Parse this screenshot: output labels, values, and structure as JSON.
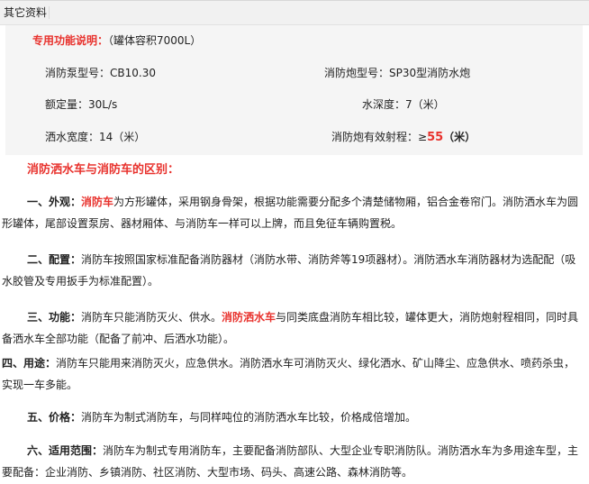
{
  "section_tab": "其它资料",
  "specs": {
    "title_label": "专用功能说明：",
    "title_note": "（罐体容积7000L）",
    "pump_model": "消防泵型号：CB10.30",
    "cannon_model": "消防炮型号：SP30型消防水炮",
    "rated_flow": "额定量：30L/s",
    "water_depth": "水深度：7（米）",
    "spray_width": "洒水宽度：14（米）",
    "range_prefix": "消防炮有效射程：≥",
    "range_value": "55",
    "range_unit": "（米）"
  },
  "diff_heading": "消防洒水车与消防车的区别：",
  "points": [
    {
      "label": "一、外观：",
      "highlight": "消防车",
      "rest": "为方形罐体，采用钢身骨架，根据功能需要分配多个清楚储物厢，铝合金卷帘门。消防洒水车为圆形罐体，尾部设置泵房、器材厢体、与消防车一样可以上牌，而且免征车辆购置税。"
    },
    {
      "label": "二、配置：",
      "text": "消防车按照国家标准配备消防器材（消防水带、消防斧等19项器材）。消防洒水车消防器材为选配配（吸水胶管及专用扳手为标准配置）。"
    },
    {
      "label": "三、功能：",
      "before": "消防车只能消防灭火、供水。",
      "highlight": "消防洒水车",
      "after": "与同类底盘消防车相比较，罐体更大，消防炮射程相同，同时具备洒水车全部功能（配备了前冲、后洒水功能）。"
    },
    {
      "label": "四、用途：",
      "text": "消防车只能用来消防灭火，应急供水。消防洒水车可消防灭火、绿化洒水、矿山降尘、应急供水、喷药杀虫，实现一车多能。"
    },
    {
      "label": "五、价格：",
      "text": "消防车为制式消防车，与同样吨位的消防洒水车比较，价格成倍增加。"
    },
    {
      "label": "六、适用范围：",
      "text": "消防车为制式专用消防车，主要配备消防部队、大型企业专职消防队。消防洒水车为多用途车型，主要配备：企业消防、乡镇消防、社区消防、大型市场、码头、高速公路、森林消防等。"
    }
  ],
  "colors": {
    "accent_red": "#e8322d",
    "spec_background": "#f5f5f5",
    "tab_background": "#f1f1f1"
  }
}
